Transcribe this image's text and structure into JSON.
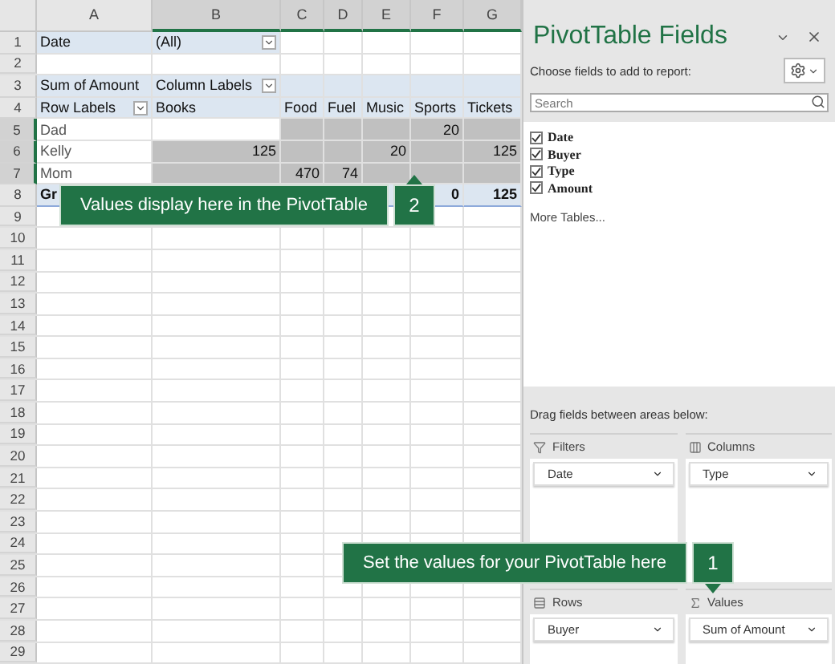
{
  "sheet": {
    "columns": [
      {
        "letter": "A",
        "selected": false
      },
      {
        "letter": "B",
        "selected": true
      },
      {
        "letter": "C",
        "selected": true
      },
      {
        "letter": "D",
        "selected": true
      },
      {
        "letter": "E",
        "selected": true
      },
      {
        "letter": "F",
        "selected": true
      },
      {
        "letter": "G",
        "selected": true
      }
    ],
    "rows": [
      {
        "number": "1",
        "kind": "filter",
        "selected": false,
        "cells": [
          {
            "text": "Date"
          },
          {
            "text": "(All)",
            "dropdown": true
          }
        ]
      },
      {
        "number": "2",
        "kind": "blank",
        "selected": false
      },
      {
        "number": "3",
        "kind": "header",
        "selected": false,
        "cells": [
          {
            "text": "Sum of Amount"
          },
          {
            "text": "Column Labels",
            "dropdown": true
          }
        ]
      },
      {
        "number": "4",
        "kind": "header",
        "selected": false,
        "cells": [
          {
            "text": "Row Labels",
            "dropdown": true
          },
          {
            "text": "Books"
          },
          {
            "text": "Food"
          },
          {
            "text": "Fuel"
          },
          {
            "text": "Music"
          },
          {
            "text": "Sports"
          },
          {
            "text": "Tickets"
          }
        ]
      },
      {
        "number": "5",
        "kind": "body",
        "selected": true,
        "cells": [
          {
            "text": "Dad"
          },
          {
            "selected": false
          },
          {
            "selected": true
          },
          {
            "selected": true
          },
          {
            "selected": true
          },
          {
            "text": "20",
            "selected": true
          },
          {
            "selected": true
          }
        ]
      },
      {
        "number": "6",
        "kind": "body",
        "selected": true,
        "cells": [
          {
            "text": "Kelly"
          },
          {
            "text": "125",
            "selected": true
          },
          {
            "selected": true
          },
          {
            "selected": true
          },
          {
            "text": "20",
            "selected": true
          },
          {
            "selected": true
          },
          {
            "text": "125",
            "selected": true
          }
        ]
      },
      {
        "number": "7",
        "kind": "body",
        "selected": true,
        "cells": [
          {
            "text": "Mom"
          },
          {
            "selected": true
          },
          {
            "text": "470",
            "selected": true
          },
          {
            "text": "74",
            "selected": true
          },
          {
            "selected": true
          },
          {
            "selected": true
          },
          {
            "selected": true
          }
        ]
      },
      {
        "number": "8",
        "kind": "total",
        "selected": false,
        "cells": [
          {
            "text": "Gr"
          },
          {},
          {},
          {},
          {},
          {
            "text": "0"
          },
          {
            "text": "125"
          }
        ]
      },
      {
        "number": "9",
        "kind": "blank",
        "selected": false
      },
      {
        "number": "10",
        "kind": "blank",
        "selected": false
      },
      {
        "number": "11",
        "kind": "blank",
        "selected": false
      },
      {
        "number": "12",
        "kind": "blank",
        "selected": false
      },
      {
        "number": "13",
        "kind": "blank",
        "selected": false
      },
      {
        "number": "14",
        "kind": "blank",
        "selected": false
      },
      {
        "number": "15",
        "kind": "blank",
        "selected": false
      },
      {
        "number": "16",
        "kind": "blank",
        "selected": false
      },
      {
        "number": "17",
        "kind": "blank",
        "selected": false
      },
      {
        "number": "18",
        "kind": "blank",
        "selected": false
      },
      {
        "number": "19",
        "kind": "blank",
        "selected": false
      },
      {
        "number": "20",
        "kind": "blank",
        "selected": false
      },
      {
        "number": "21",
        "kind": "blank",
        "selected": false
      },
      {
        "number": "22",
        "kind": "blank",
        "selected": false
      },
      {
        "number": "23",
        "kind": "blank",
        "selected": false
      },
      {
        "number": "24",
        "kind": "blank",
        "selected": false
      },
      {
        "number": "25",
        "kind": "blank",
        "selected": false
      },
      {
        "number": "26",
        "kind": "blank",
        "selected": false
      },
      {
        "number": "27",
        "kind": "blank",
        "selected": false
      },
      {
        "number": "28",
        "kind": "blank",
        "selected": false
      },
      {
        "number": "29",
        "kind": "blank",
        "selected": false
      }
    ]
  },
  "panel": {
    "title": "PivotTable Fields",
    "subtitle": "Choose fields to add to report:",
    "search": {
      "placeholder": "Search"
    },
    "fields": [
      {
        "label": "Date",
        "checked": true
      },
      {
        "label": "Buyer",
        "checked": true
      },
      {
        "label": "Type",
        "checked": true
      },
      {
        "label": "Amount",
        "checked": true
      }
    ],
    "more_link": "More Tables...",
    "areas_hint": "Drag fields between areas below:",
    "areas": [
      {
        "kind": "filters",
        "label": "Filters",
        "field": "Date"
      },
      {
        "kind": "columns",
        "label": "Columns",
        "field": "Type"
      },
      {
        "kind": "rows",
        "label": "Rows",
        "field": "Buyer"
      },
      {
        "kind": "values",
        "label": "Values",
        "field": "Sum of Amount"
      }
    ]
  },
  "callouts": [
    {
      "kind": "table",
      "text": "Values display here in the PivotTable",
      "number": "2"
    },
    {
      "kind": "panel",
      "text": "Set the values for your PivotTable here",
      "number": "1"
    }
  ]
}
